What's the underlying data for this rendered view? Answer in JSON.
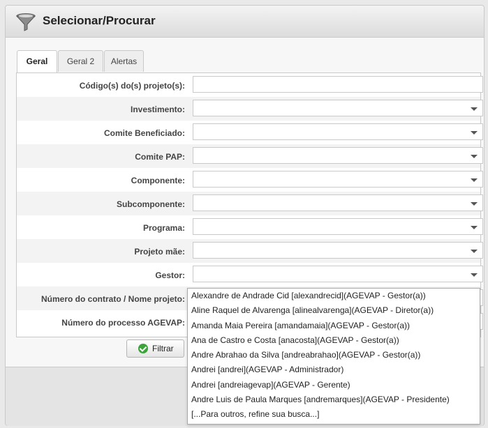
{
  "window": {
    "title": "Selecionar/Procurar",
    "icon": "funnel-icon"
  },
  "tabs": [
    {
      "label": "Geral",
      "active": true
    },
    {
      "label": "Geral 2",
      "active": false
    },
    {
      "label": "Alertas",
      "active": false
    }
  ],
  "fields": [
    {
      "label": "Código(s) do(s) projeto(s):",
      "type": "text",
      "value": ""
    },
    {
      "label": "Investimento:",
      "type": "select",
      "value": ""
    },
    {
      "label": "Comite Beneficiado:",
      "type": "select",
      "value": ""
    },
    {
      "label": "Comite PAP:",
      "type": "select",
      "value": ""
    },
    {
      "label": "Componente:",
      "type": "select",
      "value": ""
    },
    {
      "label": "Subcomponente:",
      "type": "select",
      "value": ""
    },
    {
      "label": "Programa:",
      "type": "select",
      "value": ""
    },
    {
      "label": "Projeto mãe:",
      "type": "select",
      "value": ""
    },
    {
      "label": "Gestor:",
      "type": "select",
      "value": ""
    },
    {
      "label": "Número do contrato / Nome projeto:",
      "type": "text",
      "value": ""
    },
    {
      "label": "Número do processo AGEVAP:",
      "type": "text",
      "value": ""
    }
  ],
  "actions": {
    "filter_label": "Filtrar"
  },
  "gestor_dropdown": {
    "options": [
      "Alexandre de Andrade Cid [alexandrecid](AGEVAP - Gestor(a))",
      "Aline Raquel de Alvarenga [alinealvarenga](AGEVAP - Diretor(a))",
      "Amanda Maia Pereira [amandamaia](AGEVAP - Gestor(a))",
      "Ana de Castro e Costa [anacosta](AGEVAP - Gestor(a))",
      "Andre Abrahao da Silva [andreabrahao](AGEVAP - Gestor(a))",
      "Andrei [andrei](AGEVAP - Administrador)",
      "Andrei [andreiagevap](AGEVAP - Gerente)",
      "Andre Luis de Paula Marques [andremarques](AGEVAP - Presidente)",
      "[...Para outros, refine sua busca...]"
    ]
  }
}
